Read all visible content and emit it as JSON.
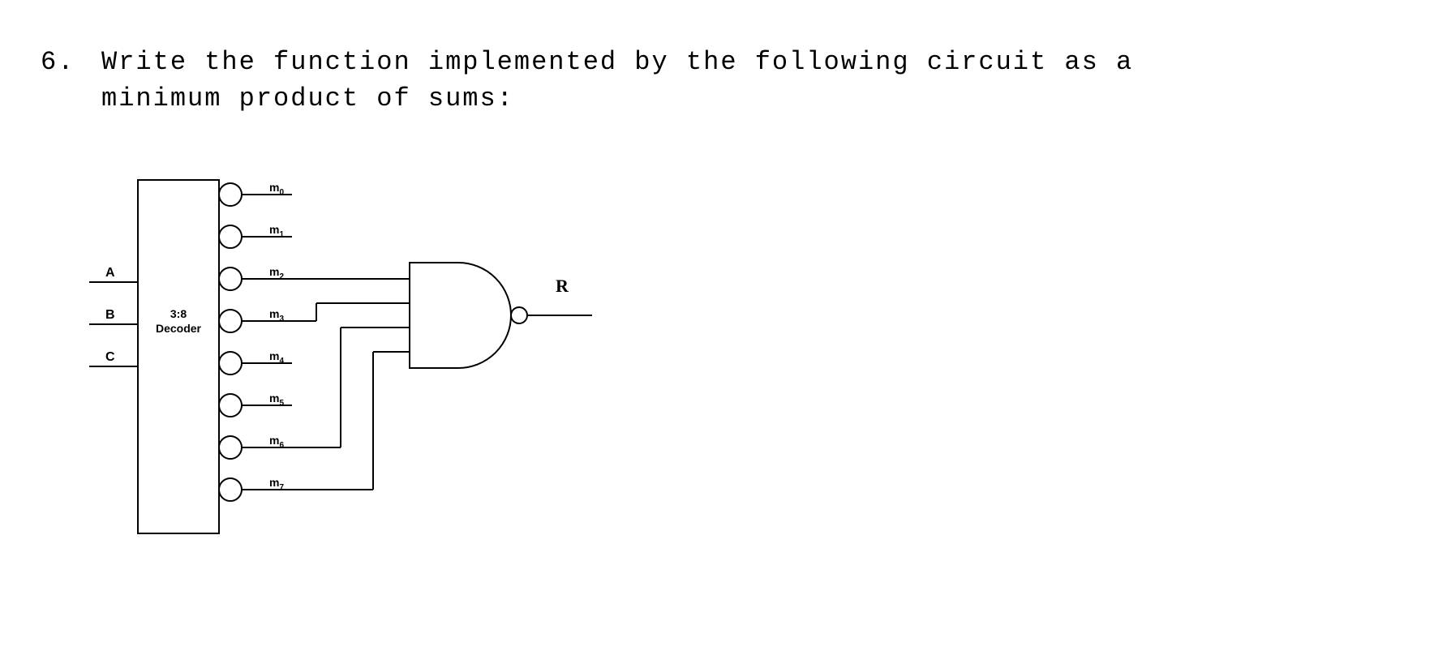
{
  "question": {
    "number": "6.",
    "text_line1": "Write the function implemented by the following circuit as a",
    "text_line2": "minimum product of sums:"
  },
  "circuit": {
    "inputs": {
      "a": "A",
      "b": "B",
      "c": "C"
    },
    "decoder": {
      "line1": "3:8",
      "line2": "Decoder"
    },
    "minterms": {
      "m0": {
        "base": "m",
        "sub": "0"
      },
      "m1": {
        "base": "m",
        "sub": "1"
      },
      "m2": {
        "base": "m",
        "sub": "2"
      },
      "m3": {
        "base": "m",
        "sub": "3"
      },
      "m4": {
        "base": "m",
        "sub": "4"
      },
      "m5": {
        "base": "m",
        "sub": "5"
      },
      "m6": {
        "base": "m",
        "sub": "6"
      },
      "m7": {
        "base": "m",
        "sub": "7"
      }
    },
    "gate": {
      "type": "NAND",
      "inputs_connected": [
        "m2",
        "m3",
        "m6",
        "m7"
      ]
    },
    "output": "R"
  }
}
